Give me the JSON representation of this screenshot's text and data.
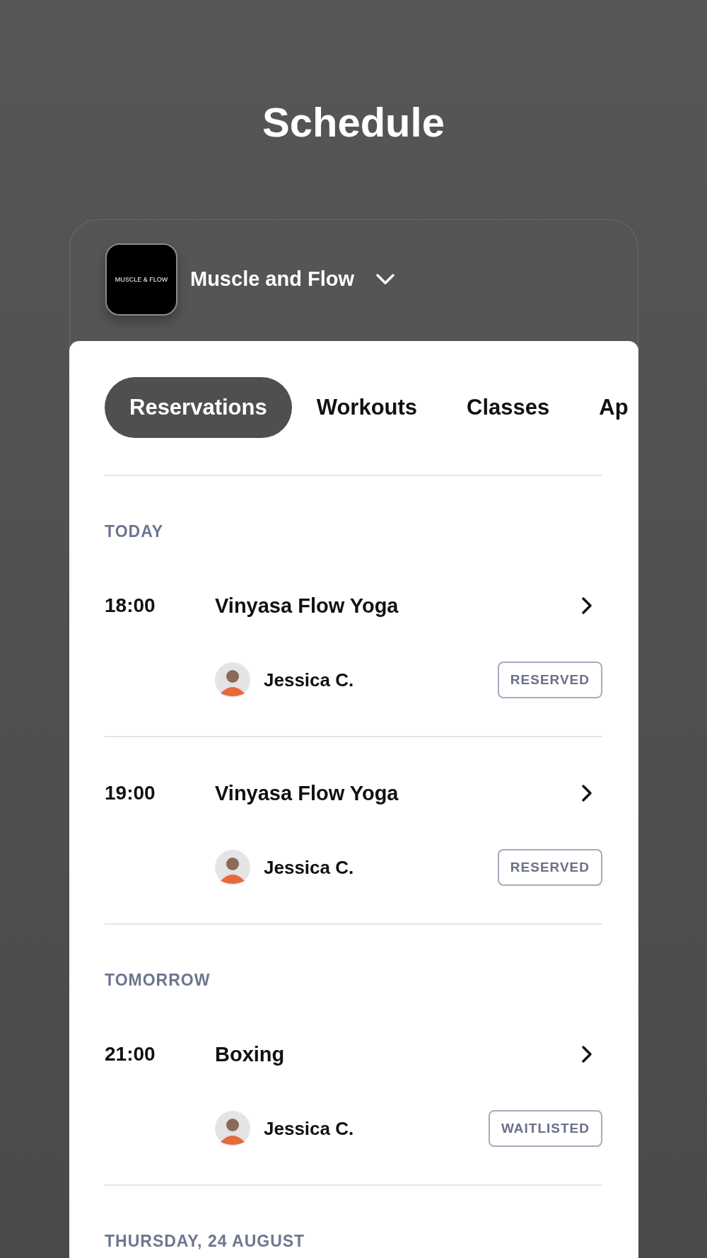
{
  "title": "Schedule",
  "studio": {
    "logo_text": "MUSCLE & FLOW",
    "name": "Muscle and Flow"
  },
  "tabs": [
    {
      "label": "Reservations",
      "selected": true
    },
    {
      "label": "Workouts",
      "selected": false
    },
    {
      "label": "Classes",
      "selected": false
    },
    {
      "label": "Ap",
      "selected": false
    }
  ],
  "sections": [
    {
      "label": "TODAY",
      "entries": [
        {
          "time": "18:00",
          "title": "Vinyasa Flow Yoga",
          "instructor": "Jessica C.",
          "status": "RESERVED"
        },
        {
          "time": "19:00",
          "title": "Vinyasa Flow Yoga",
          "instructor": "Jessica C.",
          "status": "RESERVED"
        }
      ]
    },
    {
      "label": "TOMORROW",
      "entries": [
        {
          "time": "21:00",
          "title": "Boxing",
          "instructor": "Jessica C.",
          "status": "WAITLISTED"
        }
      ]
    },
    {
      "label": "THURSDAY, 24 AUGUST"
    }
  ]
}
